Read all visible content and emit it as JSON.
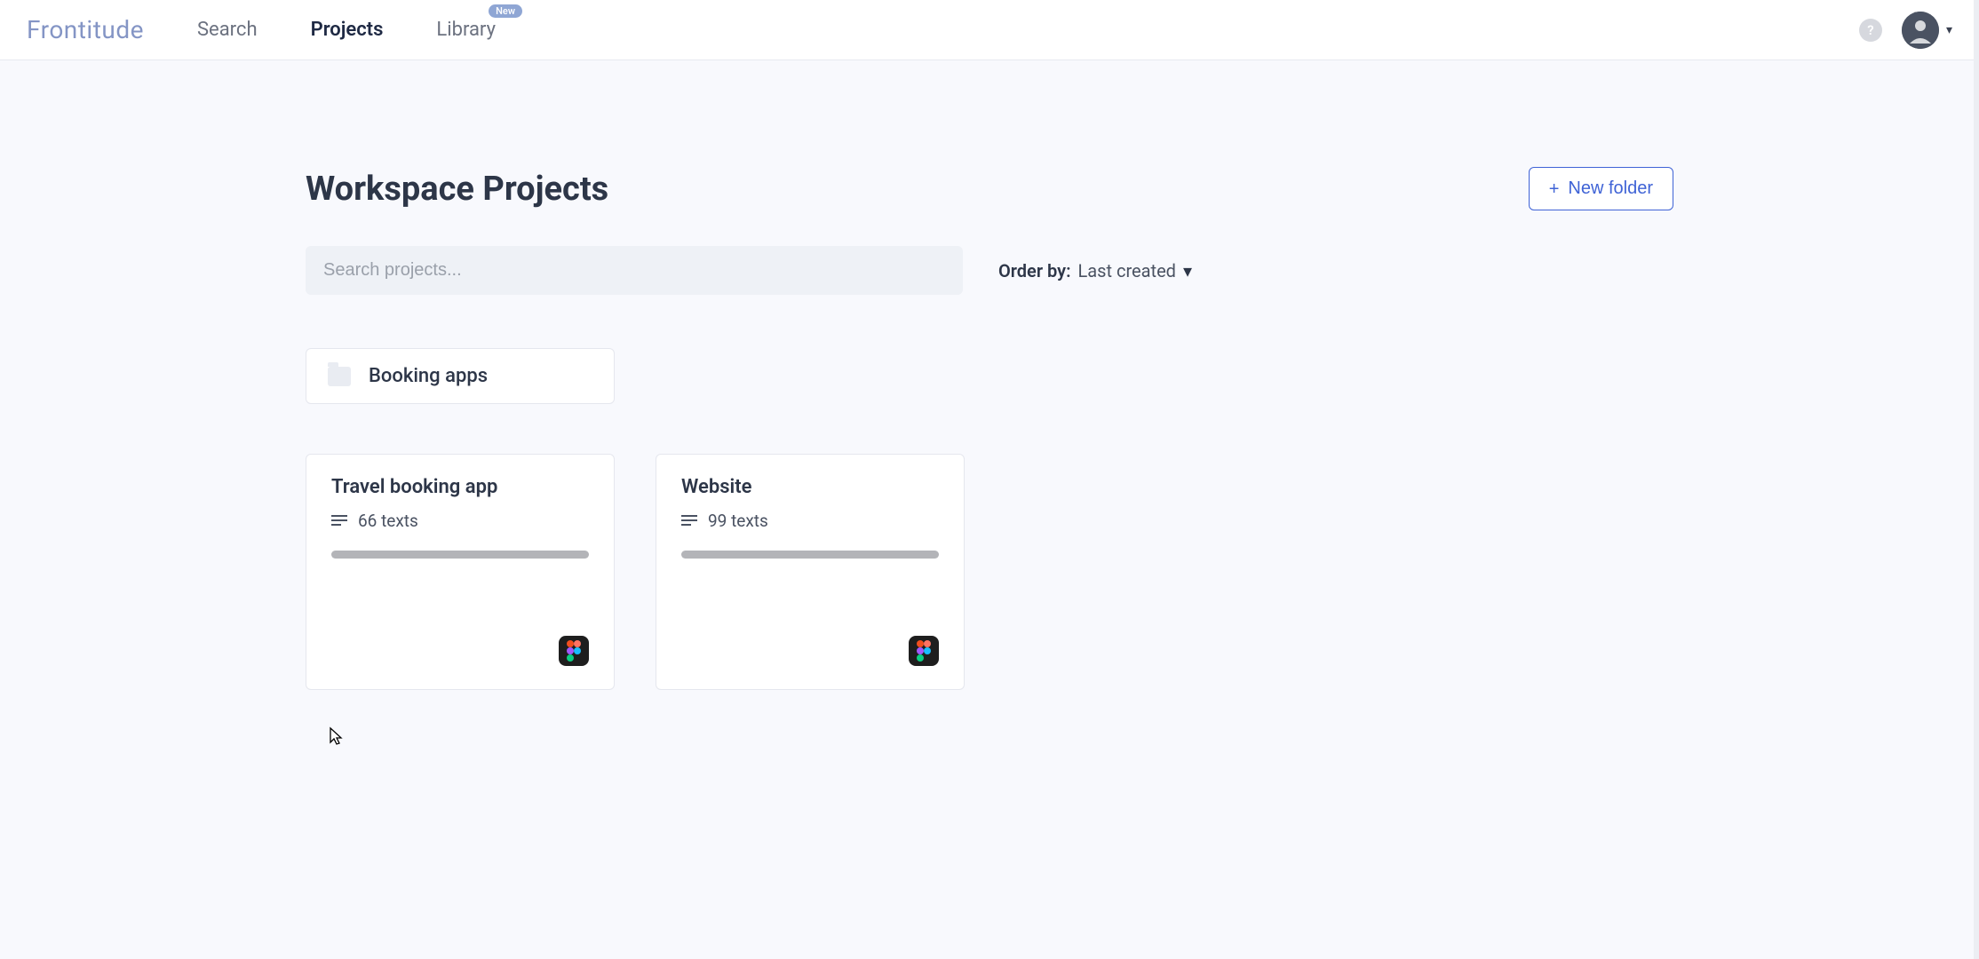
{
  "brand": "Frontitude",
  "nav": {
    "search": "Search",
    "projects": "Projects",
    "library": "Library",
    "library_badge": "New"
  },
  "help_label": "?",
  "page_title": "Workspace Projects",
  "new_folder_button": "New folder",
  "search_placeholder": "Search projects...",
  "order_by": {
    "label": "Order by:",
    "value": "Last created"
  },
  "folders": [
    {
      "name": "Booking apps"
    }
  ],
  "projects": [
    {
      "title": "Travel booking app",
      "texts": "66 texts",
      "integration": "figma"
    },
    {
      "title": "Website",
      "texts": "99 texts",
      "integration": "figma"
    }
  ]
}
